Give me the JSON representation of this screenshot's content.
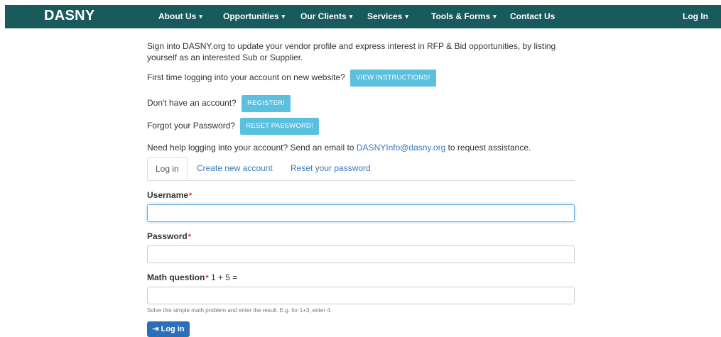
{
  "nav": {
    "brand": "DASNY",
    "items": [
      {
        "label": "About Us",
        "dropdown": true
      },
      {
        "label": "Opportunities",
        "dropdown": true
      },
      {
        "label": "Our Clients",
        "dropdown": true
      },
      {
        "label": "Services",
        "dropdown": true
      },
      {
        "label": "Tools & Forms",
        "dropdown": true
      },
      {
        "label": "Contact Us",
        "dropdown": false
      }
    ],
    "login_label": "Log In",
    "caret": "▾"
  },
  "intro": {
    "text": "Sign into DASNY.org to update your vendor profile and express interest in RFP & Bid opportunities, by listing yourself as an interested Sub or Supplier.",
    "first_time_text": "First time logging into your account on new website?",
    "view_instructions_label": "VIEW INSTRUCTIONS!",
    "no_account_text": "Don't have an account?",
    "register_label": "REGISTER!",
    "forgot_text": "Forgot your Password?",
    "reset_label": "RESET PASSWORD!",
    "help_prefix": "Need help logging into your account? Send an email to",
    "help_email": "DASNYInfo@dasny.org",
    "help_suffix": "to request assistance."
  },
  "tabs": [
    "Log in",
    "Create new account",
    "Reset your password"
  ],
  "form": {
    "username_label": "Username",
    "username_value": "",
    "password_label": "Password",
    "password_value": "",
    "math_label": "Math question",
    "math_question": "1 + 5 =",
    "math_value": "",
    "math_help": "Solve this simple math problem and enter the result. E.g. for 1+3, enter 4.",
    "required_mark": "*",
    "submit_label": "Log in"
  },
  "colors": {
    "navbar": "#195b5d",
    "info_button": "#5bc0de",
    "primary_button": "#2a6fb8",
    "link": "#3a7ab8",
    "required": "#e0302a"
  }
}
